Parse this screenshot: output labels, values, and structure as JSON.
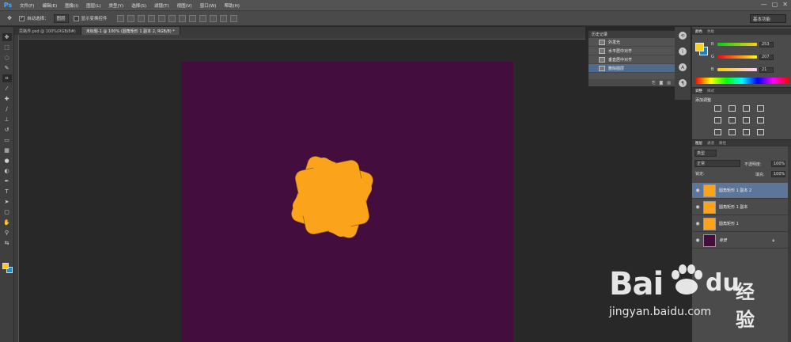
{
  "app": {
    "logo": "Ps"
  },
  "menu": [
    "文件(F)",
    "编辑(E)",
    "图像(I)",
    "图层(L)",
    "类型(Y)",
    "选择(S)",
    "滤镜(T)",
    "视图(V)",
    "窗口(W)",
    "帮助(H)"
  ],
  "window_controls": [
    "—",
    "▢",
    "✕"
  ],
  "options": {
    "auto_select_label": "自动选择：",
    "auto_select_value": "图层",
    "show_transform_label": "显示变换控件",
    "workspace": "基本功能"
  },
  "doc_tabs": [
    {
      "label": "思路界.psd @ 100%(RGB/8#)",
      "active": false
    },
    {
      "label": "未标题-1 @ 100% (圆角矩形 1 副本 2, RGB/8) *",
      "active": true
    }
  ],
  "colors": {
    "canvas_bg": "#430e3e",
    "shape_fill": "#fba41b",
    "foreground": "#fdcf15",
    "background": "#1a7fcc"
  },
  "history": {
    "title": "历史记录",
    "items": [
      {
        "label": "外发光",
        "selected": false
      },
      {
        "label": "水平居中对齐",
        "selected": false
      },
      {
        "label": "垂直居中对齐",
        "selected": false
      },
      {
        "label": "删除图层",
        "selected": true
      }
    ]
  },
  "color_panel": {
    "tabs": [
      "颜色",
      "色板"
    ],
    "r": {
      "label": "R",
      "value": "253"
    },
    "g": {
      "label": "G",
      "value": "207"
    },
    "b": {
      "label": "B",
      "value": "21"
    }
  },
  "adjustments": {
    "tabs": [
      "调整",
      "样式"
    ],
    "title": "添加调整"
  },
  "layers": {
    "tabs": [
      "图层",
      "通道",
      "路径"
    ],
    "filter": "类型",
    "blend_mode": "正常",
    "opacity_label": "不透明度:",
    "opacity": "100%",
    "lock_label": "锁定:",
    "fill_label": "填充:",
    "fill": "100%",
    "items": [
      {
        "name": "圆角矩形 1 副本 2",
        "selected": true
      },
      {
        "name": "圆角矩形 1 副本",
        "selected": false
      },
      {
        "name": "圆角矩形 1",
        "selected": false
      },
      {
        "name": "背景",
        "selected": false
      }
    ]
  },
  "watermark": {
    "brand": "Bai",
    "brand2": "du",
    "suffix": "经验",
    "url": "jingyan.baidu.com"
  }
}
